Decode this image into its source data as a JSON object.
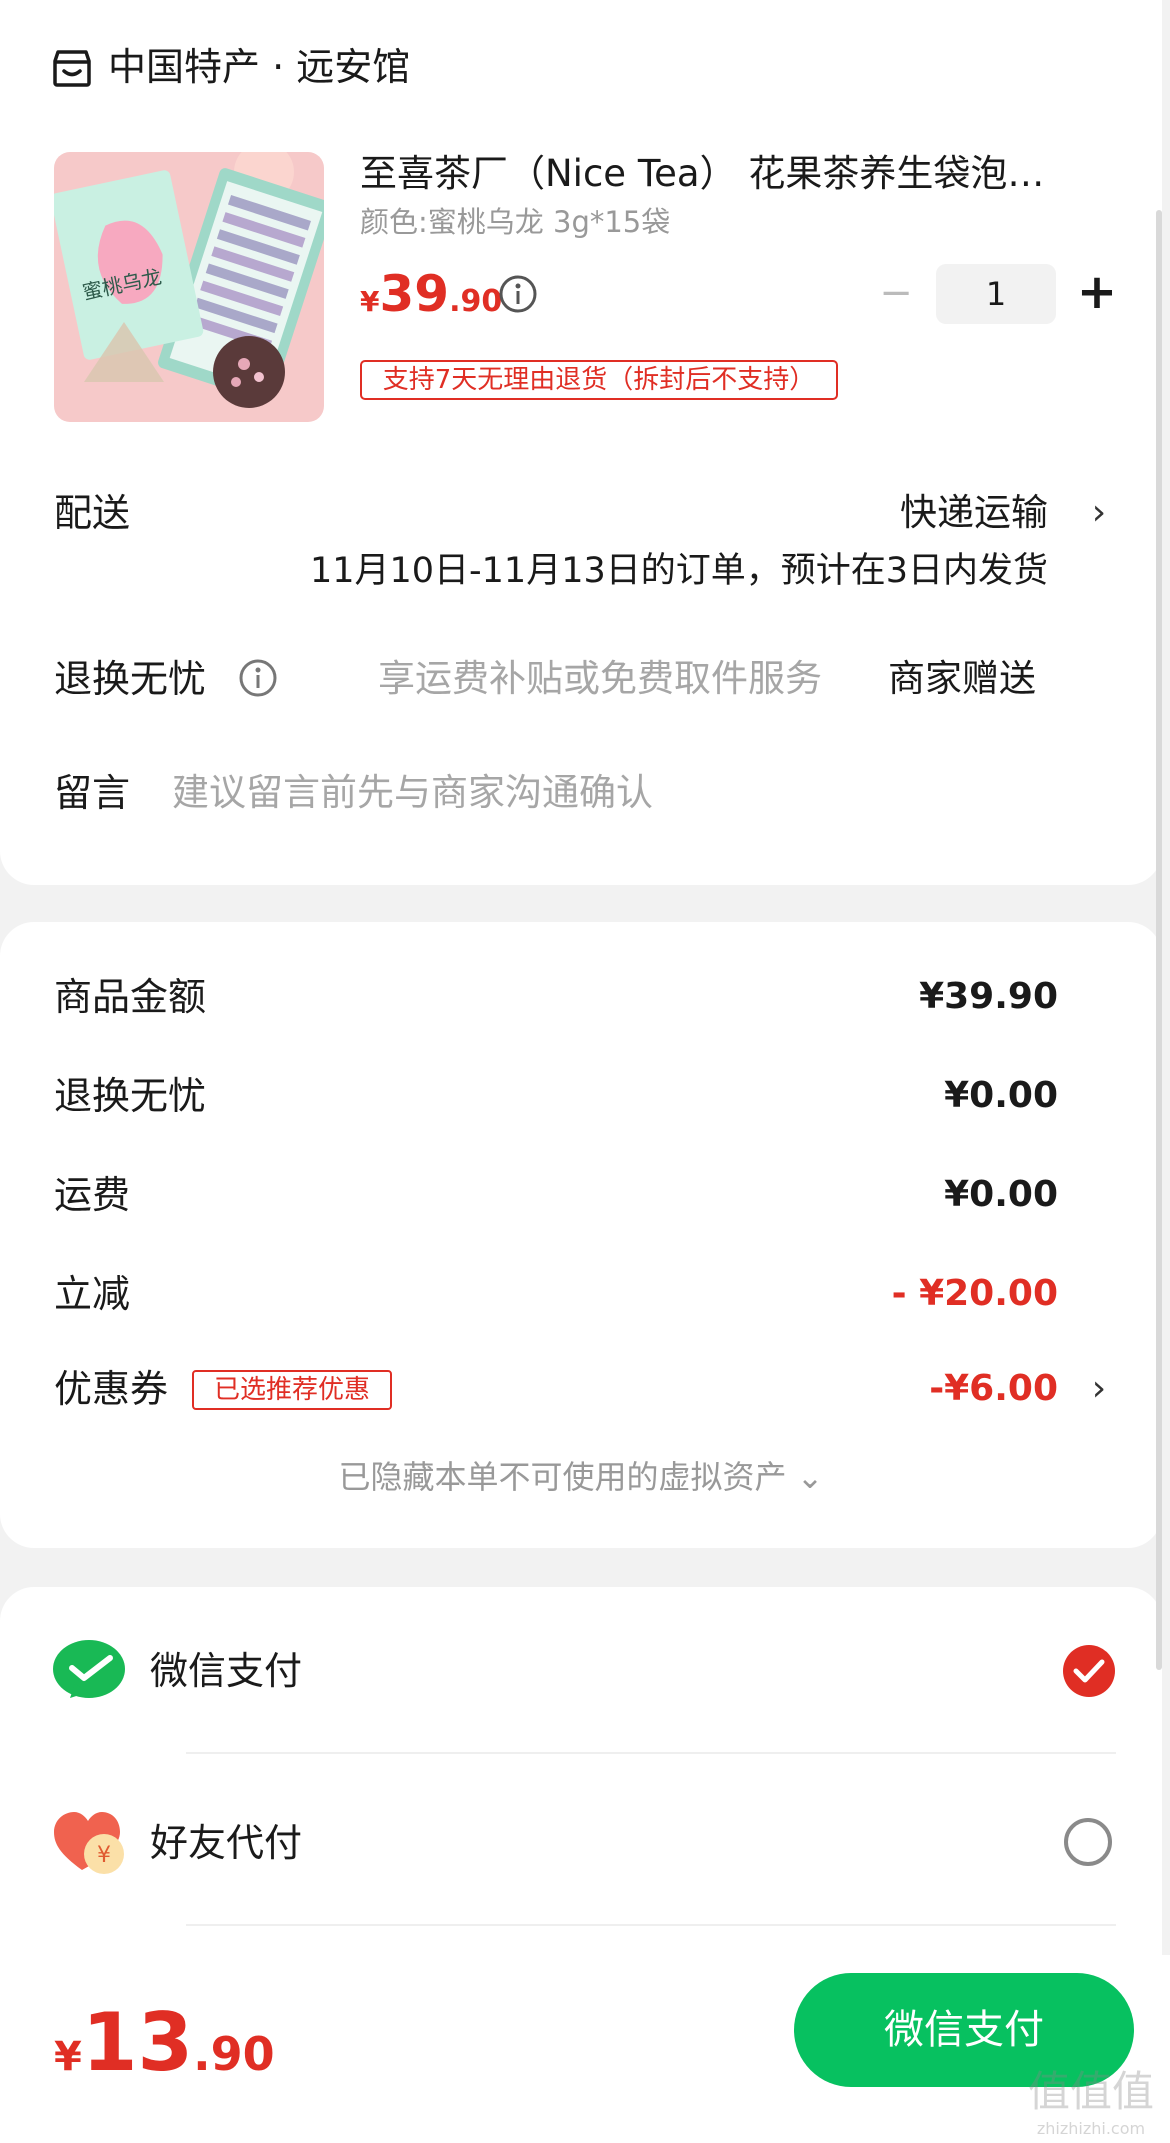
{
  "shop": {
    "name": "中国特产 · 远安馆",
    "icon": "store-icon"
  },
  "product": {
    "title": "至喜茶厂（Nice Tea） 花果茶养生袋泡…",
    "variant": "颜色:蜜桃乌龙 3g*15袋",
    "price_symbol": "¥",
    "price_int": "39",
    "price_dec": ".90",
    "quantity": "1",
    "refund_tag": "支持7天无理由退货（拆封后不支持）",
    "image_text": "蜜桃乌龙"
  },
  "delivery": {
    "label": "配送",
    "method": "快递运输",
    "note": "11月10日-11月13日的订单，预计在3日内发货"
  },
  "returns": {
    "label": "退换无忧",
    "desc": "享运费补贴或免费取件服务",
    "value": "商家赠送"
  },
  "message": {
    "label": "留言",
    "placeholder": "建议留言前先与商家沟通确认"
  },
  "summary": {
    "items": [
      {
        "label": "商品金额",
        "value": "¥39.90"
      },
      {
        "label": "退换无忧",
        "value": "¥0.00"
      },
      {
        "label": "运费",
        "value": "¥0.00"
      },
      {
        "label": "立减",
        "value": "- ¥20.00"
      }
    ],
    "coupon": {
      "label": "优惠券",
      "tag": "已选推荐优惠",
      "value": "-¥6.00"
    },
    "hidden_note": "已隐藏本单不可使用的虚拟资产 ⌄"
  },
  "payment": {
    "options": [
      {
        "label": "微信支付",
        "icon": "wechat-pay-icon",
        "selected": true
      },
      {
        "label": "好友代付",
        "icon": "friend-pay-icon",
        "selected": false
      }
    ]
  },
  "footer": {
    "total_symbol": "¥",
    "total_int": "13",
    "total_dec": ".90",
    "pay_button": "微信支付"
  },
  "watermark": "值值值 zhizhizhi.com",
  "colors": {
    "accent_red": "#e02e24",
    "wechat_green": "#07c160"
  }
}
